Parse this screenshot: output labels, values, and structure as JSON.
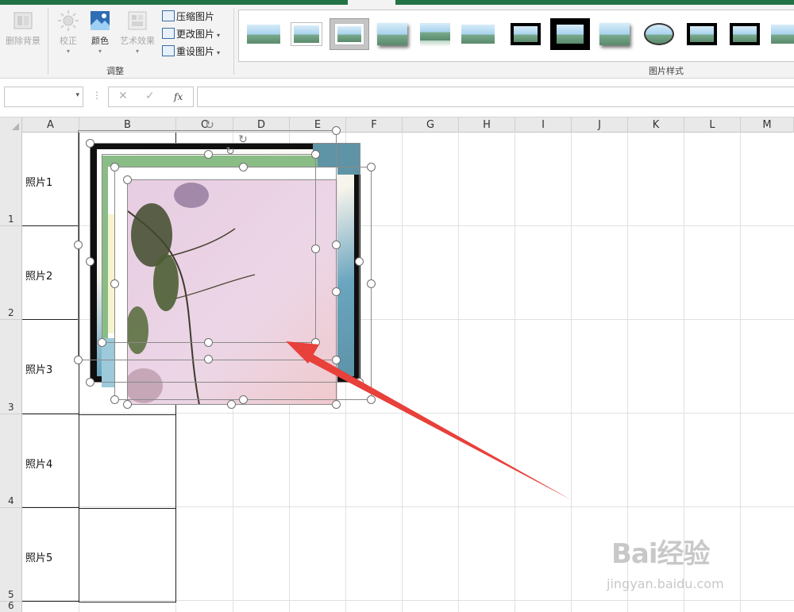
{
  "ribbon": {
    "adjust_group": {
      "label": "调整",
      "remove_bg": "删除背景",
      "corrections": "校正",
      "color": "颜色",
      "artistic": "艺术效果",
      "compress": "压缩图片",
      "change": "更改图片",
      "reset": "重设图片"
    },
    "styles_group": {
      "label": "图片样式"
    }
  },
  "formula_bar": {
    "name_box": "",
    "cancel": "✕",
    "enter": "✓",
    "fx": "fx",
    "formula": ""
  },
  "columns": [
    "A",
    "B",
    "C",
    "D",
    "E",
    "F",
    "G",
    "H",
    "I",
    "J",
    "K",
    "L",
    "M"
  ],
  "rows": [
    "1",
    "2",
    "3",
    "4",
    "5",
    "6"
  ],
  "cells": [
    "照片1",
    "照片2",
    "照片3",
    "照片4",
    "照片5"
  ],
  "colors": {
    "excel_green": "#217346",
    "arrow_red": "#e8403a",
    "handle_border": "#6f6f6f"
  },
  "watermark": {
    "big": "Bai经验",
    "small": "jingyan.baidu.com"
  }
}
